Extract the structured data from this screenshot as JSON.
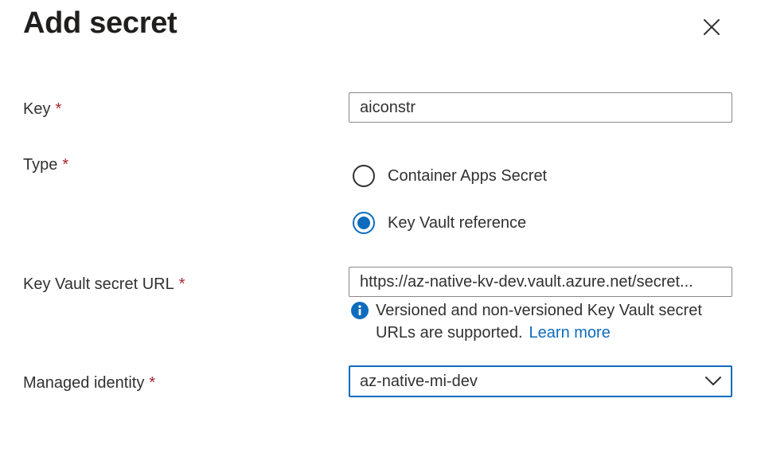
{
  "panel": {
    "title": "Add secret",
    "close_icon": "close-icon"
  },
  "form": {
    "required_marker": "*",
    "key": {
      "label": "Key",
      "value": "aiconstr"
    },
    "type": {
      "label": "Type",
      "options": [
        {
          "label": "Container Apps Secret",
          "selected": false
        },
        {
          "label": "Key Vault reference",
          "selected": true
        }
      ]
    },
    "kv_url": {
      "label": "Key Vault secret URL",
      "value": "https://az-native-kv-dev.vault.azure.net/secret...",
      "info_icon": "info-icon",
      "info_text": "Versioned and non-versioned Key Vault secret URLs are supported.",
      "learn_more": "Learn more"
    },
    "managed_identity": {
      "label": "Managed identity",
      "value": "az-native-mi-dev",
      "chevron_icon": "chevron-down-icon"
    }
  },
  "colors": {
    "accent": "#0f6cbd",
    "required": "#a4262c",
    "text": "#323130",
    "border": "#8a8886"
  }
}
